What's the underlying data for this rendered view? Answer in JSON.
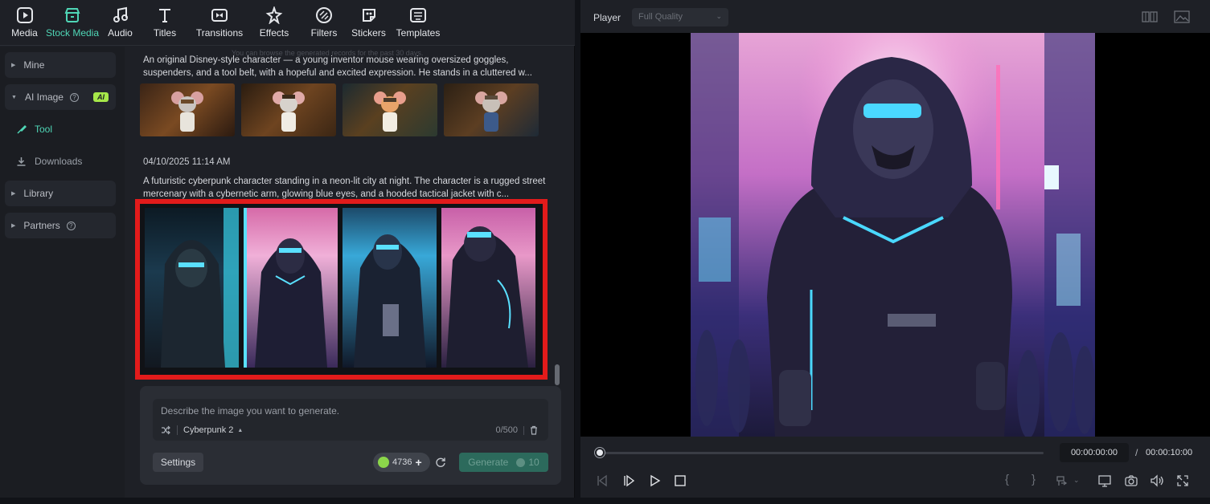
{
  "toolbar": {
    "items": [
      {
        "label": "Media",
        "icon": "media-icon"
      },
      {
        "label": "Stock Media",
        "icon": "stock-media-icon",
        "active": true
      },
      {
        "label": "Audio",
        "icon": "audio-icon"
      },
      {
        "label": "Titles",
        "icon": "titles-icon"
      },
      {
        "label": "Transitions",
        "icon": "transitions-icon"
      },
      {
        "label": "Effects",
        "icon": "effects-icon"
      },
      {
        "label": "Filters",
        "icon": "filters-icon"
      },
      {
        "label": "Stickers",
        "icon": "stickers-icon"
      },
      {
        "label": "Templates",
        "icon": "templates-icon"
      }
    ]
  },
  "sidebar": {
    "mine": "Mine",
    "ai_image": "AI Image",
    "ai_badge": "AI",
    "tool": "Tool",
    "downloads": "Downloads",
    "library": "Library",
    "partners": "Partners"
  },
  "content": {
    "hint": "You can browse the generated records for the past 30 days.",
    "record1": {
      "prompt": "An original Disney-style character — a young inventor mouse wearing oversized goggles, suspenders, and a tool belt, with a hopeful and excited expression. He stands in a cluttered w..."
    },
    "record2": {
      "date": "04/10/2025 11:14 AM",
      "prompt": "A futuristic cyberpunk character standing in a neon-lit city at night. The character is a rugged street mercenary with a cybernetic arm, glowing blue eyes, and a hooded tactical jacket with c..."
    }
  },
  "generator": {
    "placeholder": "Describe the image you want to generate.",
    "style": "Cyberpunk 2",
    "char_count": "0/500",
    "settings_label": "Settings",
    "credits": "4736",
    "generate_label": "Generate",
    "generate_cost": "10"
  },
  "player": {
    "title": "Player",
    "quality": "Full Quality",
    "current_time": "00:00:00:00",
    "separator": "/",
    "total_time": "00:00:10:00",
    "progress": 0
  },
  "colors": {
    "accent": "#4fd6b6",
    "selection": "#e21b1b",
    "panel": "#1e2026"
  }
}
